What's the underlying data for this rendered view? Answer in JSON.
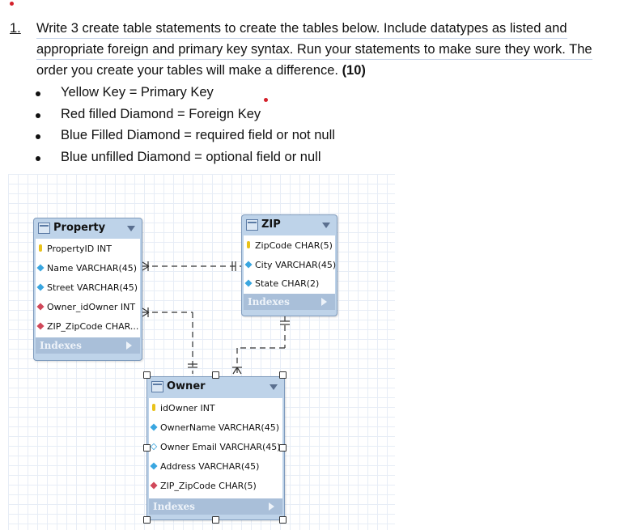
{
  "question": {
    "number": "1.",
    "lines": [
      "Write 3 create table statements to create the tables below.  Include datatypes as listed and",
      "appropriate foreign and primary key syntax.  Run your statements to make sure they work. The",
      "order you create your tables will make a difference."
    ],
    "points": "(10)"
  },
  "legend": [
    "Yellow Key = Primary Key",
    "Red filled Diamond = Foreign Key",
    "Blue Filled Diamond = required field or not null",
    "Blue unfilled Diamond = optional field or null"
  ],
  "diagram": {
    "index_label": "Indexes",
    "tables": [
      {
        "name": "Property",
        "columns": [
          {
            "icon": "yellow-key-icon",
            "text": "PropertyID INT"
          },
          {
            "icon": "blue-filled-diamond-icon",
            "text": "Name VARCHAR(45)"
          },
          {
            "icon": "blue-filled-diamond-icon",
            "text": "Street VARCHAR(45)"
          },
          {
            "icon": "red-filled-diamond-icon",
            "text": "Owner_idOwner INT"
          },
          {
            "icon": "red-filled-diamond-icon",
            "text": "ZIP_ZipCode CHAR..."
          }
        ]
      },
      {
        "name": "ZIP",
        "columns": [
          {
            "icon": "yellow-key-icon",
            "text": "ZipCode CHAR(5)"
          },
          {
            "icon": "blue-filled-diamond-icon",
            "text": "City VARCHAR(45)"
          },
          {
            "icon": "blue-filled-diamond-icon",
            "text": "State CHAR(2)"
          }
        ]
      },
      {
        "name": "Owner",
        "columns": [
          {
            "icon": "yellow-key-icon",
            "text": "idOwner INT"
          },
          {
            "icon": "blue-filled-diamond-icon",
            "text": "OwnerName VARCHAR(45)"
          },
          {
            "icon": "blue-unfilled-diamond-icon",
            "text": "Owner Email VARCHAR(45)"
          },
          {
            "icon": "blue-filled-diamond-icon",
            "text": "Address VARCHAR(45)"
          },
          {
            "icon": "red-filled-diamond-icon",
            "text": "ZIP_ZipCode CHAR(5)"
          }
        ]
      }
    ]
  }
}
